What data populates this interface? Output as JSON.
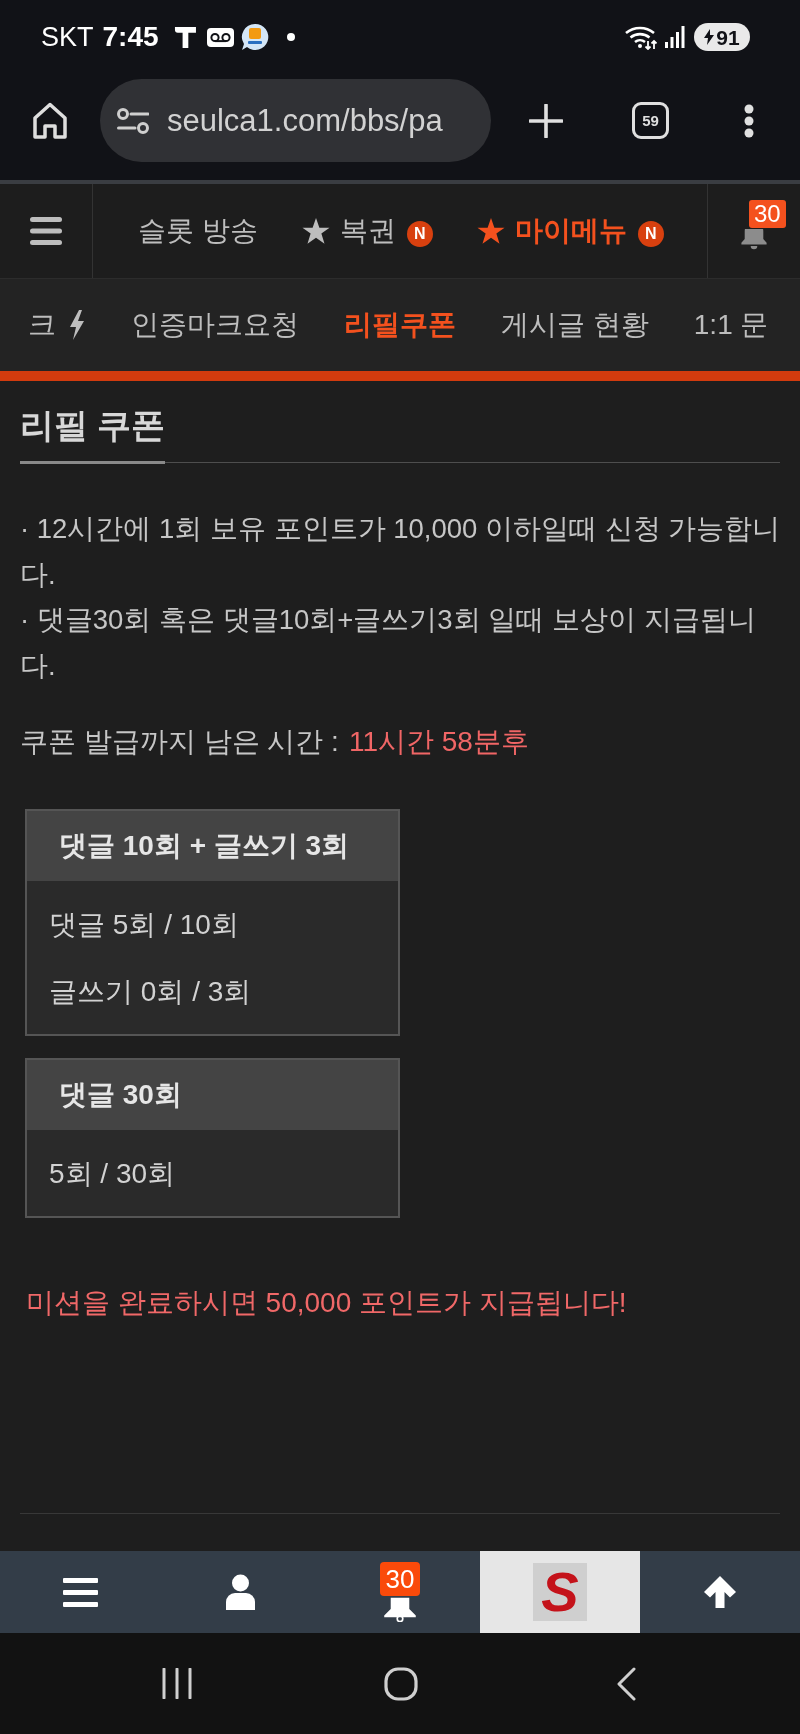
{
  "status_bar": {
    "carrier": "SKT",
    "time": "7:45",
    "battery": "91"
  },
  "browser": {
    "url": "seulca1.com/bbs/pa",
    "tab_count": "59"
  },
  "top_menu": {
    "items": [
      {
        "label": "슬롯 방송",
        "star": false,
        "selected": false
      },
      {
        "label": "복권",
        "star": true,
        "badge": "N",
        "selected": false
      },
      {
        "label": "마이메뉴",
        "star": true,
        "badge": "N",
        "selected": true
      }
    ],
    "notification_count": "30"
  },
  "sub_menu": {
    "items": [
      {
        "label": "크",
        "icon": true,
        "selected": false
      },
      {
        "label": "인증마크요청",
        "icon": false,
        "selected": false
      },
      {
        "label": "리필쿠폰",
        "icon": false,
        "selected": true
      },
      {
        "label": "게시글 현황",
        "icon": false,
        "selected": false
      },
      {
        "label": "1:1 문",
        "icon": false,
        "selected": false
      }
    ]
  },
  "page": {
    "title": "리필 쿠폰",
    "notices": [
      "· 12시간에 1회 보유 포인트가 10,000 이하일때 신청 가능합니다.",
      "· 댓글30회 혹은 댓글10회+글쓰기3회 일때 보상이 지급됩니다."
    ],
    "countdown": {
      "label": "쿠폰 발급까지 남은 시간 :",
      "value": "11시간 58분후"
    },
    "missions": [
      {
        "title": "댓글 10회 + 글쓰기 3회",
        "counts": [
          "댓글 5회 / 10회",
          "글쓰기 0회 / 3회"
        ]
      },
      {
        "title": "댓글 30회",
        "counts": [
          "5회 / 30회"
        ]
      }
    ],
    "reward": "미션을 완료하시면 50,000 포인트가 지급됩니다!"
  },
  "bottom_nav": {
    "notification_count": "30",
    "logo": "S"
  }
}
